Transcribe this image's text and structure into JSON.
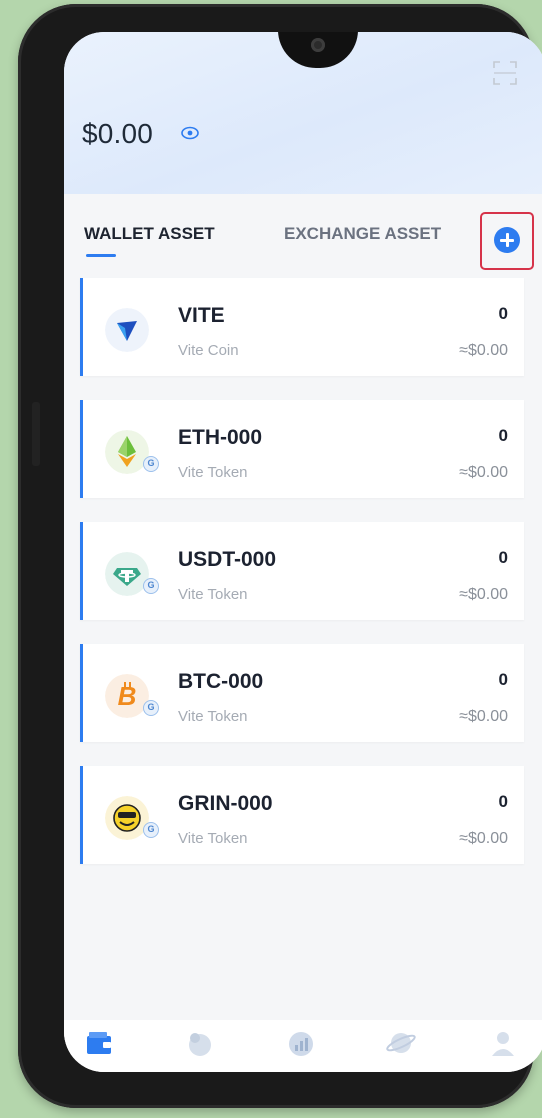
{
  "header": {
    "balance": "$0.00",
    "scan_icon": "scan-icon",
    "visibility_icon": "eye-icon"
  },
  "tabs": {
    "wallet": "WALLET ASSET",
    "exchange": "EXCHANGE ASSET",
    "add_icon": "plus-circle-icon"
  },
  "tokens": [
    {
      "symbol": "VITE",
      "type": "Vite Coin",
      "amount": "0",
      "value": "≈$0.00",
      "icon": "vite-logo-icon"
    },
    {
      "symbol": "ETH-000",
      "type": "Vite Token",
      "amount": "0",
      "value": "≈$0.00",
      "icon": "eth-logo-icon"
    },
    {
      "symbol": "USDT-000",
      "type": "Vite Token",
      "amount": "0",
      "value": "≈$0.00",
      "icon": "usdt-logo-icon"
    },
    {
      "symbol": "BTC-000",
      "type": "Vite Token",
      "amount": "0",
      "value": "≈$0.00",
      "icon": "btc-logo-icon"
    },
    {
      "symbol": "GRIN-000",
      "type": "Vite Token",
      "amount": "0",
      "value": "≈$0.00",
      "icon": "grin-logo-icon"
    }
  ],
  "gateway_badge": "G",
  "bottom_nav": [
    {
      "icon": "wallet-icon",
      "active": true
    },
    {
      "icon": "exchange-icon",
      "active": false
    },
    {
      "icon": "stats-icon",
      "active": false
    },
    {
      "icon": "explore-planet-icon",
      "active": false
    },
    {
      "icon": "profile-icon",
      "active": false
    }
  ],
  "colors": {
    "accent": "#2d7cf0",
    "highlight_border": "#d6334a",
    "background": "#b4d6ac"
  }
}
